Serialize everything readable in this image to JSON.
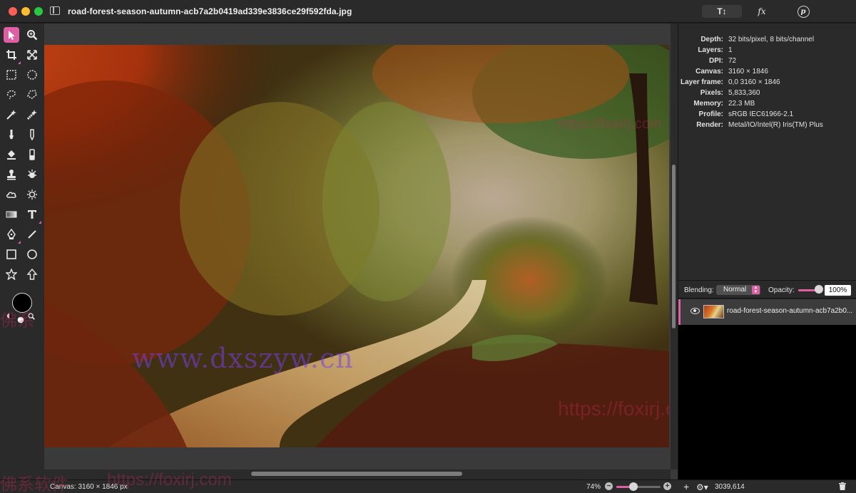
{
  "window": {
    "title": "road-forest-season-autumn-acb7a2b0419ad339e3836ce29f592fda.jpg",
    "toolbar_tabs": [
      "T↕",
      "fx",
      "p"
    ]
  },
  "info": [
    {
      "label": "Depth:",
      "value": "32 bits/pixel, 8 bits/channel"
    },
    {
      "label": "Layers:",
      "value": "1"
    },
    {
      "label": "DPI:",
      "value": "72"
    },
    {
      "label": "Canvas:",
      "value": "3160 × 1846"
    },
    {
      "label": "Layer frame:",
      "value": "0,0 3160 × 1846"
    },
    {
      "label": "Pixels:",
      "value": "5,833,360"
    },
    {
      "label": "Memory:",
      "value": "22.3 MB"
    },
    {
      "label": "Profile:",
      "value": "sRGB IEC61966-2.1"
    },
    {
      "label": "Render:",
      "value": "Metal/IO/Intel(R) Iris(TM) Plus"
    }
  ],
  "layers_bar": {
    "blending_label": "Blending:",
    "blending_value": "Normal",
    "opacity_label": "Opacity:",
    "opacity_value": "100%",
    "opacity_fraction": 1.0
  },
  "layers": [
    {
      "name": "road-forest-season-autumn-acb7a2b0...",
      "visible": true
    }
  ],
  "status": {
    "canvas": "Canvas: 3160 × 1846 px",
    "zoom": "74%",
    "zoom_fraction": 0.4,
    "coords": "3039,614"
  },
  "watermarks": {
    "main": "www.dxszyw.cn",
    "url": "https://foxirj.com",
    "cn_left": "佛系",
    "cn_bottom": "佛系软件",
    "url_bottom": "https://foxirj.com"
  },
  "colors": {
    "accent": "#e05fa4",
    "foreground": "#000000",
    "background": "#ffffff"
  }
}
